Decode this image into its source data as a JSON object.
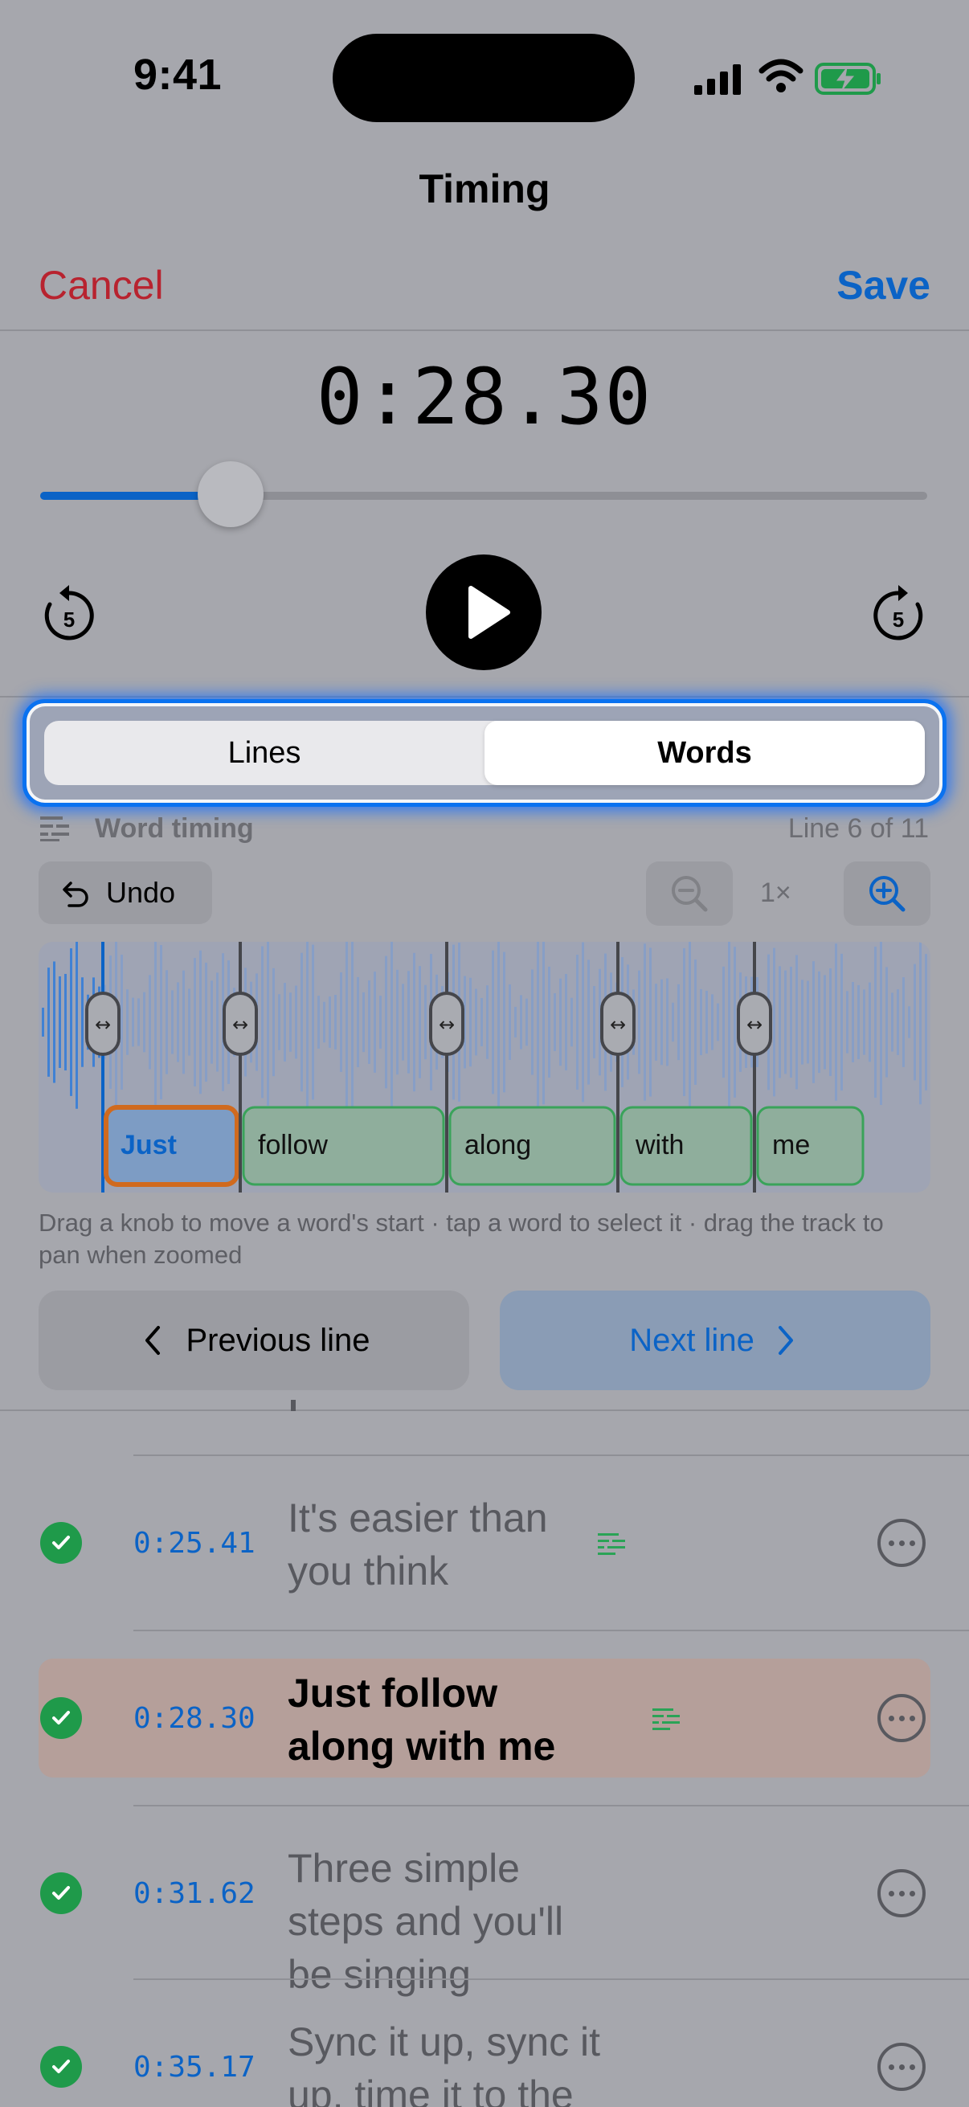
{
  "status_bar": {
    "time": "9:41"
  },
  "nav": {
    "title": "Timing",
    "cancel_label": "Cancel",
    "save_label": "Save"
  },
  "player": {
    "current_time": "0:28.30",
    "progress": 0.215,
    "skip_back_seconds": "5",
    "skip_forward_seconds": "5"
  },
  "mode_selector": {
    "options": [
      "Lines",
      "Words"
    ],
    "selected": "Words"
  },
  "word_timing": {
    "label": "Word timing",
    "line_counter": "Line 6 of 11",
    "undo_label": "Undo",
    "zoom_level": "1×",
    "words": [
      "Just",
      "follow",
      "along",
      "with",
      "me"
    ],
    "selected_word": "Just",
    "hint": "Drag a knob to move a word's start · tap a word to select it · drag the track to pan when zoomed"
  },
  "navigation": {
    "previous_label": "Previous line",
    "next_label": "Next line"
  },
  "lines": [
    {
      "time": "0:25.41",
      "text": "It's easier than you think",
      "done": true,
      "has_word_timing": true
    },
    {
      "time": "0:28.30",
      "text": "Just follow along with me",
      "done": true,
      "has_word_timing": true,
      "active": true
    },
    {
      "time": "0:31.62",
      "text": "Three simple steps and you'll be singing",
      "done": true,
      "has_word_timing": false
    },
    {
      "time": "0:35.17",
      "text": "Sync it up, sync it up, time it to the beat",
      "done": true,
      "has_word_timing": false
    }
  ],
  "colors": {
    "accent": "#0b63c6",
    "destructive": "#b8232f",
    "success": "#1f9a4a",
    "selection": "#d06a1e"
  }
}
